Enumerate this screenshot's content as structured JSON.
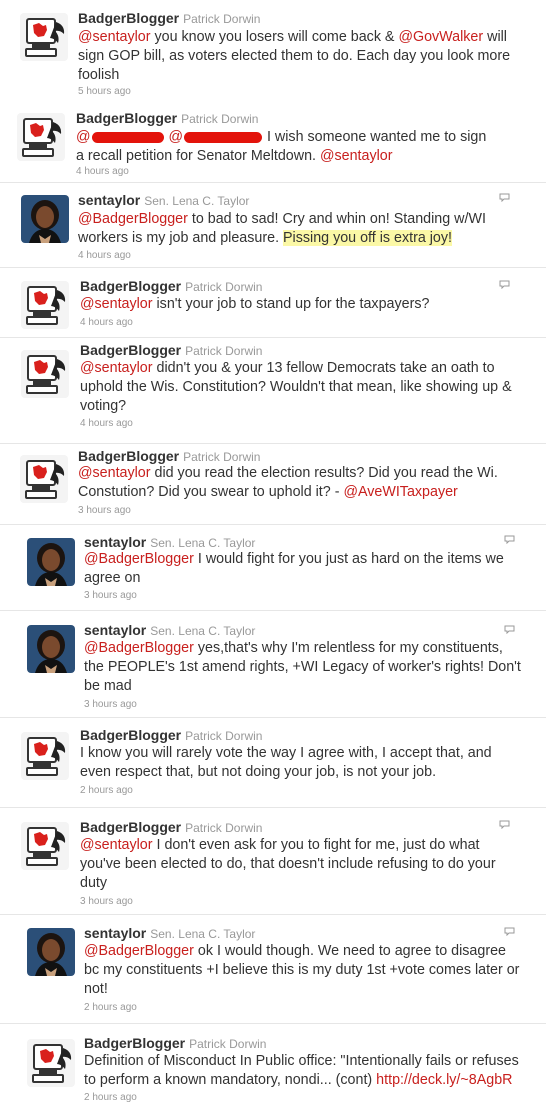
{
  "tweets": [
    {
      "handle": "BadgerBlogger",
      "name": "Patrick Dorwin",
      "m1": "@sentaylor",
      "t1": " you know you losers will come back & ",
      "m2": "@GovWalker",
      "t2": " will sign GOP bill, as voters elected them to do. Each day you look more foolish",
      "time": "5 hours ago"
    },
    {
      "handle": "BadgerBlogger",
      "name": "Patrick Dorwin",
      "a1": "@",
      "a2": " @",
      "t1": " I wish someone wanted me to sign a recall petition for Senator Meltdown. ",
      "m1": "@sentaylor",
      "time": "4 hours ago"
    },
    {
      "handle": "sentaylor",
      "name": "Sen. Lena C. Taylor",
      "m1": "@BadgerBlogger",
      "t1": " to bad to sad! Cry and whin on! Standing w/WI workers is my job and pleasure. ",
      "hl": "Pissing you off is extra joy!",
      "time": "4 hours ago"
    },
    {
      "handle": "BadgerBlogger",
      "name": "Patrick Dorwin",
      "m1": "@sentaylor",
      "t1": " isn't your job to stand up for the taxpayers?",
      "time": "4 hours ago"
    },
    {
      "handle": "BadgerBlogger",
      "name": "Patrick Dorwin",
      "m1": "@sentaylor",
      "t1": " didn't you & your 13 fellow Democrats take an oath to uphold the Wis. Constitution? Wouldn't that mean, like showing up & voting?",
      "time": "4 hours ago"
    },
    {
      "handle": "BadgerBlogger",
      "name": "Patrick Dorwin",
      "m1": "@sentaylor",
      "t1": " did you read the election results? Did you read the Wi. Constution? Did you swear to uphold it? - ",
      "m2": "@AveWITaxpayer",
      "time": "3 hours ago"
    },
    {
      "handle": "sentaylor",
      "name": "Sen. Lena C. Taylor",
      "m1": "@BadgerBlogger",
      "t1": " I would fight for you just as hard on the items we agree on",
      "time": "3 hours ago"
    },
    {
      "handle": "sentaylor",
      "name": "Sen. Lena C. Taylor",
      "m1": "@BadgerBlogger",
      "t1": " yes,that's why I'm relentless for my constituents, the PEOPLE's 1st amend rights, +WI Legacy of worker's rights! Don't be mad",
      "time": "3 hours ago"
    },
    {
      "handle": "BadgerBlogger",
      "name": "Patrick Dorwin",
      "t1": "I know you will rarely vote the way I agree with, I accept that, and even respect that, but not doing your job, is not your job.",
      "time": "2 hours ago"
    },
    {
      "handle": "BadgerBlogger",
      "name": "Patrick Dorwin",
      "m1": "@sentaylor",
      "t1": " I don't even ask for you to fight for me, just do what you've been elected to do, that doesn't include refusing to do your duty",
      "time": "3 hours ago"
    },
    {
      "handle": "sentaylor",
      "name": "Sen. Lena C. Taylor",
      "m1": "@BadgerBlogger",
      "t1": " ok I would though. We need to agree to disagree bc my constituents +I believe this is my duty 1st +vote comes later or not!",
      "time": "2 hours ago"
    },
    {
      "handle": "BadgerBlogger",
      "name": "Patrick Dorwin",
      "t1": "Definition of Misconduct In Public office: \"Intentionally fails or refuses to perform a known mandatory, nondi... (cont) ",
      "link": "http://deck.ly/~8AgbR",
      "time": "2 hours ago"
    }
  ]
}
